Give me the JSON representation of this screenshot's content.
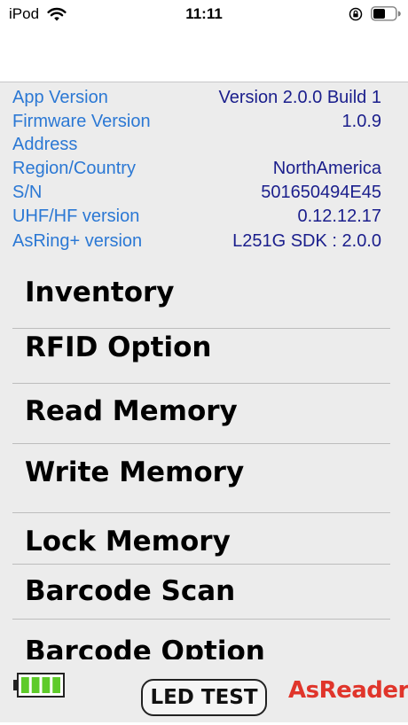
{
  "status_bar": {
    "carrier": "iPod",
    "time": "11:11",
    "icons": [
      "wifi-icon",
      "orientation-lock-icon",
      "battery-icon"
    ]
  },
  "device_info": [
    {
      "label": "App Version",
      "value": "Version 2.0.0 Build 1"
    },
    {
      "label": "Firmware Version",
      "value": "1.0.9"
    },
    {
      "label": "Address",
      "value": ""
    },
    {
      "label": "Region/Country",
      "value": "NorthAmerica"
    },
    {
      "label": "S/N",
      "value": "501650494E45"
    },
    {
      "label": "UHF/HF version",
      "value": "0.12.12.17"
    },
    {
      "label": "AsRing+ version",
      "value": "L251G SDK : 2.0.0"
    }
  ],
  "menu": {
    "items": [
      {
        "label": "Inventory"
      },
      {
        "label": "RFID Option"
      },
      {
        "label": "Read Memory"
      },
      {
        "label": "Write Memory"
      },
      {
        "label": "Lock Memory"
      },
      {
        "label": "Barcode Scan"
      },
      {
        "label": "Barcode Option"
      }
    ]
  },
  "footer": {
    "battery_bars": 4,
    "battery_bars_total": 4,
    "led_test_label": "LED TEST",
    "logo_text": "AsReader"
  },
  "colors": {
    "label_blue": "#2b78d4",
    "value_navy": "#1a1e8c",
    "battery_green": "#5ecb2a",
    "logo_red": "#e0352b"
  }
}
